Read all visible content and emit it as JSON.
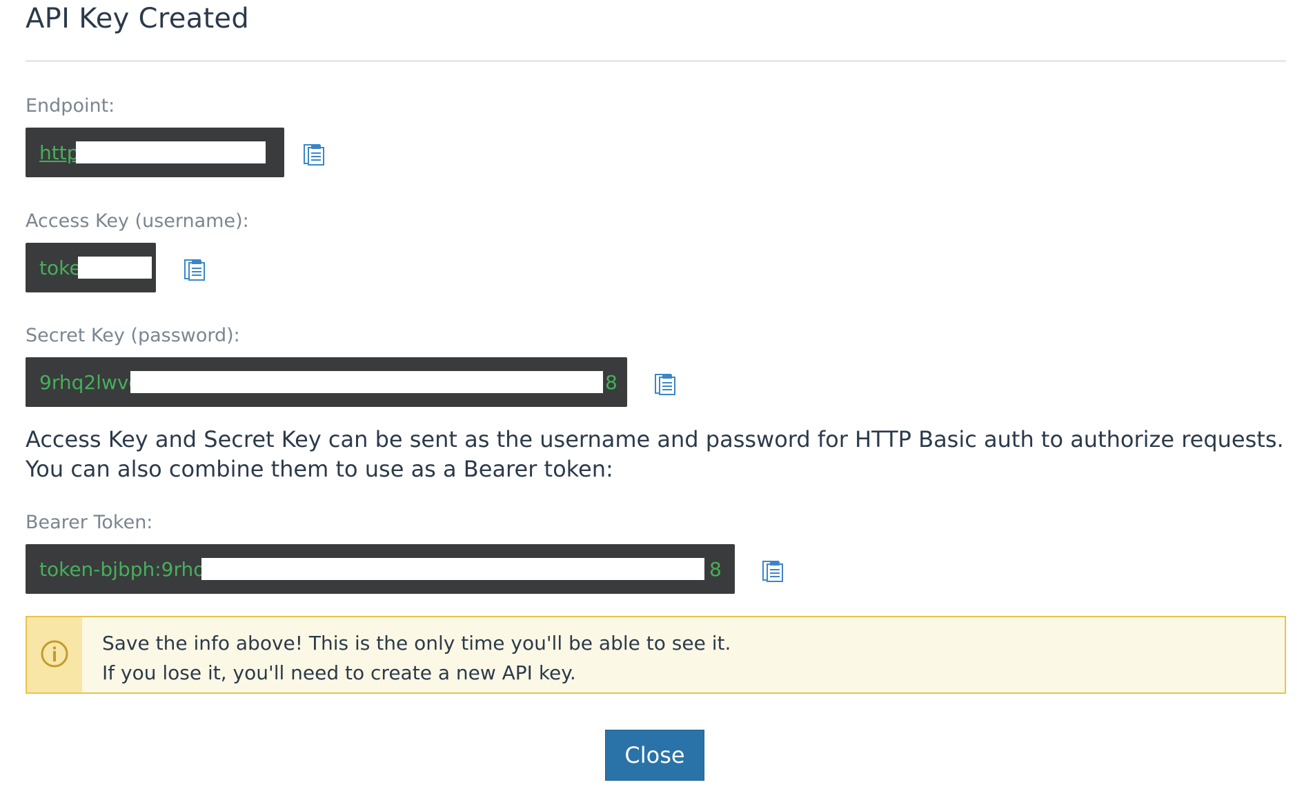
{
  "dialog": {
    "title": "API Key Created"
  },
  "fields": {
    "endpoint": {
      "label": "Endpoint:",
      "value": "http",
      "copy_icon": "clipboard-icon"
    },
    "access_key": {
      "label": "Access Key (username):",
      "value": "toke",
      "copy_icon": "clipboard-icon"
    },
    "secret_key": {
      "label": "Secret Key (password):",
      "value": "9rhq2lwvg",
      "value_tail": "8",
      "copy_icon": "clipboard-icon"
    },
    "bearer_token": {
      "label": "Bearer Token:",
      "value": "token-bjbph:9rhq2l",
      "value_tail": "8",
      "copy_icon": "clipboard-icon"
    }
  },
  "info_text": "Access Key and Secret Key can be sent as the username and password for HTTP Basic auth to authorize requests. You can also combine them to use as a Bearer token:",
  "warning": {
    "icon": "info-circle-icon",
    "line1": "Save the info above! This is the only time you'll be able to see it.",
    "line2": "If you lose it, you'll need to create a new API key."
  },
  "actions": {
    "close_label": "Close"
  },
  "colors": {
    "code_background": "#3a3b3d",
    "code_text": "#46b05a",
    "primary_button": "#2a73a8",
    "warning_border": "#e8c349",
    "warning_background": "#fcf8e6",
    "warning_icon_background": "#f7e6a6",
    "copy_icon": "#3a86c8"
  }
}
